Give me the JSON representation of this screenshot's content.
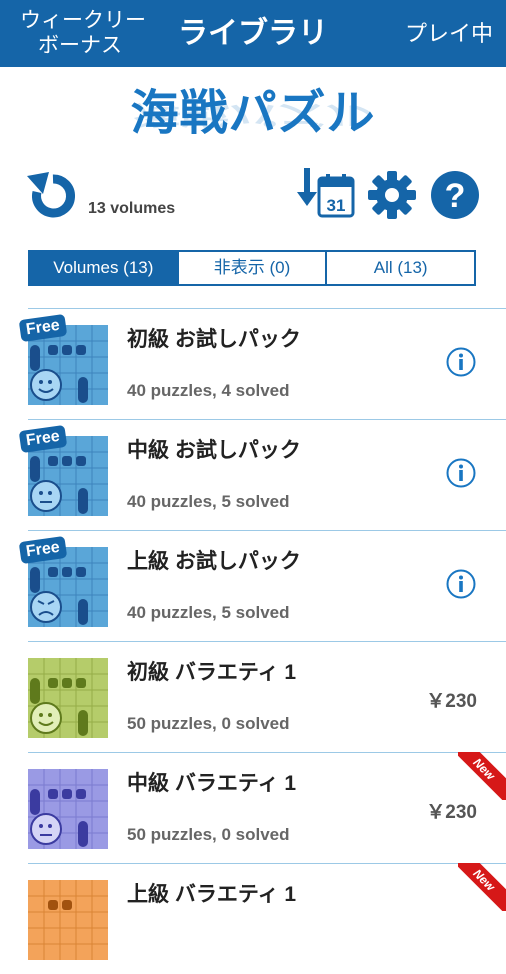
{
  "header": {
    "left_line1": "ウィークリー",
    "left_line2": "ボーナス",
    "title": "ライブラリ",
    "right": "プレイ中"
  },
  "logo": {
    "text": "海戦パズル"
  },
  "toolbar": {
    "volumes_count": "13 volumes",
    "calendar_day": "31",
    "icons": [
      "refresh-icon",
      "sort-by-date-icon",
      "settings-gear-icon",
      "help-icon"
    ]
  },
  "tabs": [
    {
      "label": "Volumes (13)",
      "active": true
    },
    {
      "label": "非表示 (0)",
      "active": false
    },
    {
      "label": "All (13)",
      "active": false
    }
  ],
  "items": [
    {
      "name": "初級 お試しパック",
      "stats": "40 puzzles,  4 solved",
      "badge": "Free",
      "price": "",
      "action": "info",
      "theme": "blue"
    },
    {
      "name": "中級 お試しパック",
      "stats": "40 puzzles,  5 solved",
      "badge": "Free",
      "price": "",
      "action": "info",
      "theme": "blue"
    },
    {
      "name": "上級 お試しパック",
      "stats": "40 puzzles,  5 solved",
      "badge": "Free",
      "price": "",
      "action": "info",
      "theme": "blue"
    },
    {
      "name": "初級 バラエティ 1",
      "stats": "50 puzzles,  0 solved",
      "badge": "",
      "price": "￥230",
      "action": "price",
      "theme": "green"
    },
    {
      "name": "中級 バラエティ 1",
      "stats": "50 puzzles,  0 solved",
      "badge": "New",
      "price": "￥230",
      "action": "price",
      "theme": "purple"
    },
    {
      "name": "上級 バラエティ 1",
      "stats": "",
      "badge": "New",
      "price": "",
      "action": "none",
      "theme": "orange"
    }
  ],
  "colors": {
    "brand": "#1565a8",
    "accent": "#1976c2",
    "new_ribbon": "#d61818"
  }
}
